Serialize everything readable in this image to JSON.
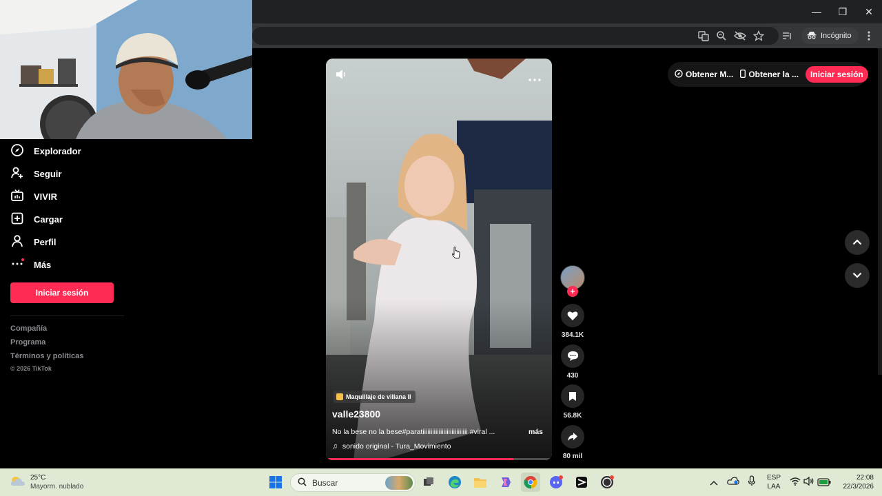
{
  "browser": {
    "incognito_label": "Incógnito"
  },
  "sidebar": {
    "items": [
      {
        "label": "Explorador",
        "icon": "compass-icon"
      },
      {
        "label": "Seguir",
        "icon": "follow-user-icon"
      },
      {
        "label": "VIVIR",
        "icon": "live-tv-icon"
      },
      {
        "label": "Cargar",
        "icon": "upload-plus-icon"
      },
      {
        "label": "Perfil",
        "icon": "profile-icon"
      },
      {
        "label": "Más",
        "icon": "more-dots-icon"
      }
    ],
    "login_label": "Iniciar sesión",
    "footer": [
      "Compañía",
      "Programa",
      "Términos y políticas",
      "© 2026 TikTok"
    ]
  },
  "topbar": {
    "get_app_label": "Obtener M...",
    "get_mobile_label": "Obtener la ...",
    "signin_label": "Iniciar sesión"
  },
  "video": {
    "effect_label": "Maquillaje de villana II",
    "username": "valle23800",
    "caption": "No la bese no la bese#paratiiiiiiiiiiiiiiiiiiiiiiiiiiii #viral ...",
    "more_label": "más",
    "sound": "sonido original - Tura_Movimiento",
    "progress": 0.83
  },
  "actions": {
    "likes": "384.1K",
    "comments": "430",
    "saves": "56.8K",
    "shares": "80 mil"
  },
  "taskbar": {
    "weather_temp": "25°C",
    "weather_desc": "Mayorm. nublado",
    "search_placeholder": "Buscar",
    "lang_top": "ESP",
    "lang_bottom": "LAA",
    "time": "22:08",
    "date": "22/3/2026"
  },
  "colors": {
    "accent": "#fe2c55",
    "background": "#000000",
    "taskbar": "#dfe9d4"
  }
}
